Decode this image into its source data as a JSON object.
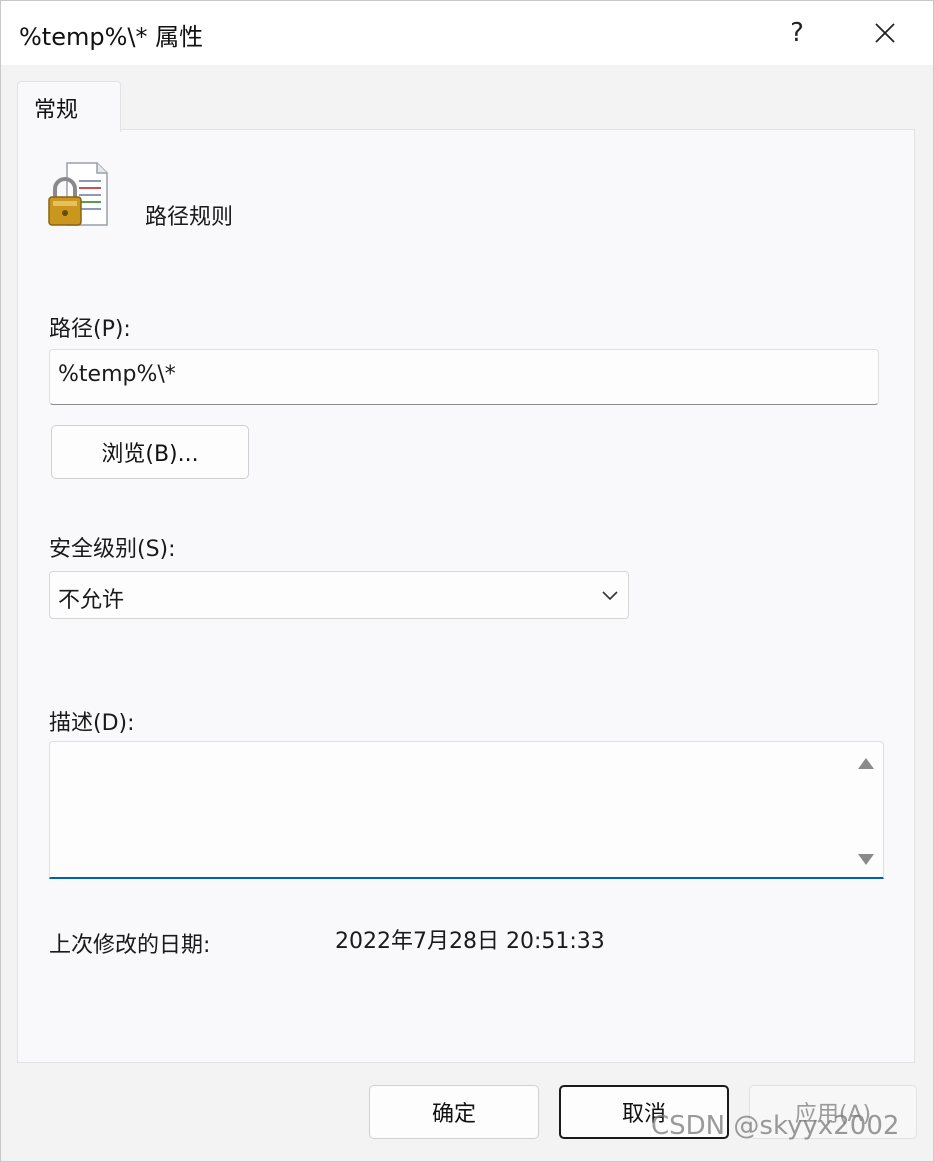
{
  "window": {
    "title": "%temp%\\* 属性",
    "help_label": "?",
    "close_label": "✕"
  },
  "tabs": [
    {
      "label": "常规",
      "selected": true
    }
  ],
  "rule": {
    "icon": "lock-document-icon",
    "name": "路径规则"
  },
  "path": {
    "label": "路径(P):",
    "value": "%temp%\\*",
    "browse_label": "浏览(B)..."
  },
  "security": {
    "label": "安全级别(S):",
    "selected": "不允许"
  },
  "description": {
    "label": "描述(D):",
    "value": ""
  },
  "modified": {
    "label": "上次修改的日期:",
    "value": "2022年7月28日   20:51:33"
  },
  "buttons": {
    "ok": "确定",
    "cancel": "取消",
    "apply": "应用(A)"
  },
  "watermark": "CSDN @skyyx2002",
  "colors": {
    "accent": "#005fb8",
    "lock_gold": "#c9961e"
  }
}
